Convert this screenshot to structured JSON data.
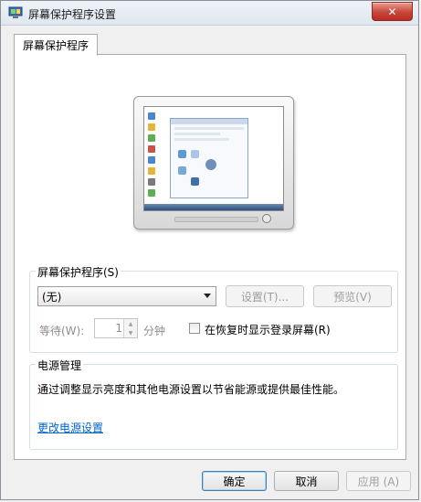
{
  "window": {
    "title": "屏幕保护程序设置",
    "close_glyph": "✕"
  },
  "tabs": [
    {
      "label": "屏幕保护程序"
    }
  ],
  "screensaver": {
    "group_label": "屏幕保护程序(S)",
    "selected": "(无)",
    "settings_label": "设置(T)...",
    "preview_label": "预览(V)",
    "wait_label": "等待(W):",
    "wait_value": "1",
    "wait_unit": "分钟",
    "resume_label": "在恢复时显示登录屏幕(R)",
    "resume_checked": false
  },
  "power": {
    "group_label": "电源管理",
    "description": "通过调整显示亮度和其他电源设置以节省能源或提供最佳性能。",
    "link_label": "更改电源设置"
  },
  "buttons": {
    "ok": "确定",
    "cancel": "取消",
    "apply": "应用 (A)"
  },
  "colors": {
    "link": "#0066cc",
    "close": "#c7453a",
    "disabled_text": "#9e9e9e"
  }
}
